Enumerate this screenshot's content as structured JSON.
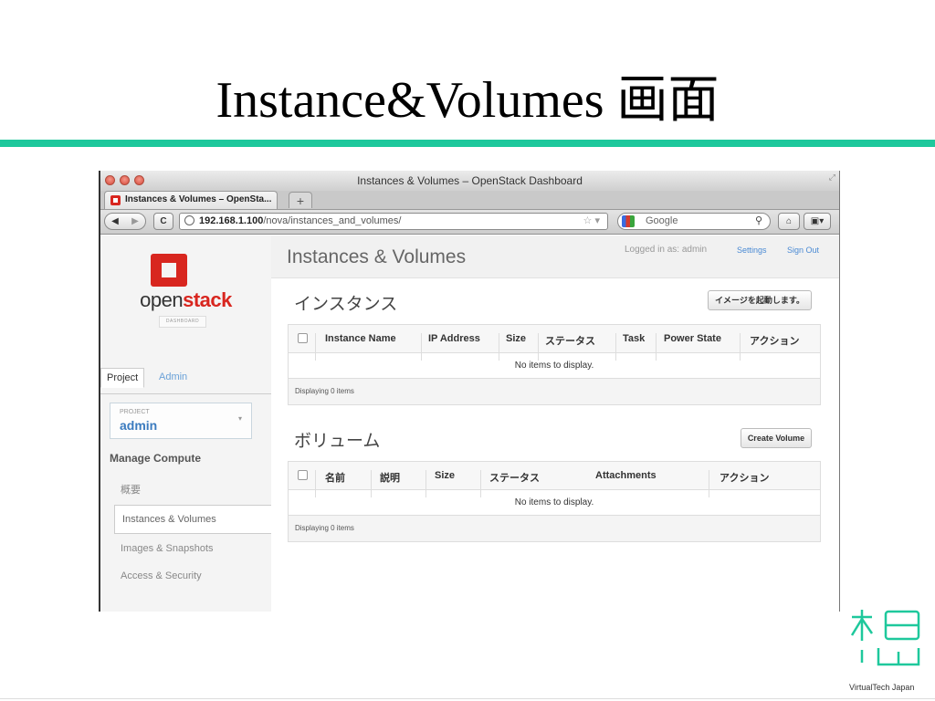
{
  "slide": {
    "title": "Instance&Volumes 画面",
    "vt_logo_text": "VirtualTech Japan"
  },
  "browser": {
    "window_title": "Instances & Volumes – OpenStack Dashboard",
    "tab_title": "Instances & Volumes – OpenSta...",
    "new_tab_symbol": "+",
    "url_host": "192.168.1.100",
    "url_path": "/nova/instances_and_volumes/",
    "search_placeholder": "Google",
    "back_icon": "◀",
    "forward_icon": "▶",
    "reload_icon": "C",
    "home_icon": "⌂",
    "ext_icon": "▣▾"
  },
  "sidebar": {
    "brand_open": "open",
    "brand_stack": "stack",
    "brand_sub": "DASHBOARD",
    "tabs": [
      "Project",
      "Admin"
    ],
    "project_label": "PROJECT",
    "project_name": "admin",
    "section_heading": "Manage Compute",
    "items": [
      "概要",
      "Instances & Volumes",
      "Images & Snapshots",
      "Access & Security"
    ]
  },
  "header": {
    "page_title": "Instances & Volumes",
    "logged_in": "Logged in as: admin",
    "settings": "Settings",
    "sign_out": "Sign Out"
  },
  "instances": {
    "title": "インスタンス",
    "launch_button": "イメージを起動します。",
    "columns": [
      "Instance Name",
      "IP Address",
      "Size",
      "ステータス",
      "Task",
      "Power State",
      "アクション"
    ],
    "empty_message": "No items to display.",
    "footer": "Displaying 0 items"
  },
  "volumes": {
    "title": "ボリューム",
    "create_button": "Create Volume",
    "columns": [
      "名前",
      "説明",
      "Size",
      "ステータス",
      "Attachments",
      "アクション"
    ],
    "empty_message": "No items to display.",
    "footer": "Displaying 0 items"
  },
  "colors": {
    "accent_rule": "#1ec89c",
    "openstack_red": "#d8261f",
    "link_blue": "#4a8ad4"
  }
}
